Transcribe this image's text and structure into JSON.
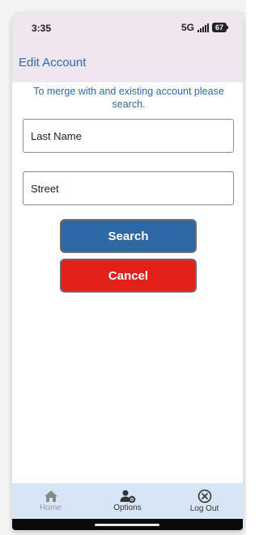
{
  "status_bar": {
    "time": "3:35",
    "network": "5G",
    "battery": "67"
  },
  "header": {
    "title": "Edit Account"
  },
  "instruction": "To merge with and existing account please search.",
  "form": {
    "last_name_placeholder": "Last Name",
    "street_placeholder": "Street"
  },
  "buttons": {
    "search_label": "Search",
    "cancel_label": "Cancel"
  },
  "bottom_nav": {
    "home_label": "Home",
    "options_label": "Options",
    "logout_label": "Log Out"
  },
  "colors": {
    "accent": "#2e6ba5",
    "search_button": "#2d68a4",
    "cancel_button": "#e3211b",
    "header_bg": "#efe6ef",
    "nav_bg": "#d6e6f7"
  },
  "icons": {
    "home": "home-icon",
    "options": "user-gear-icon",
    "logout": "close-circle-icon"
  }
}
